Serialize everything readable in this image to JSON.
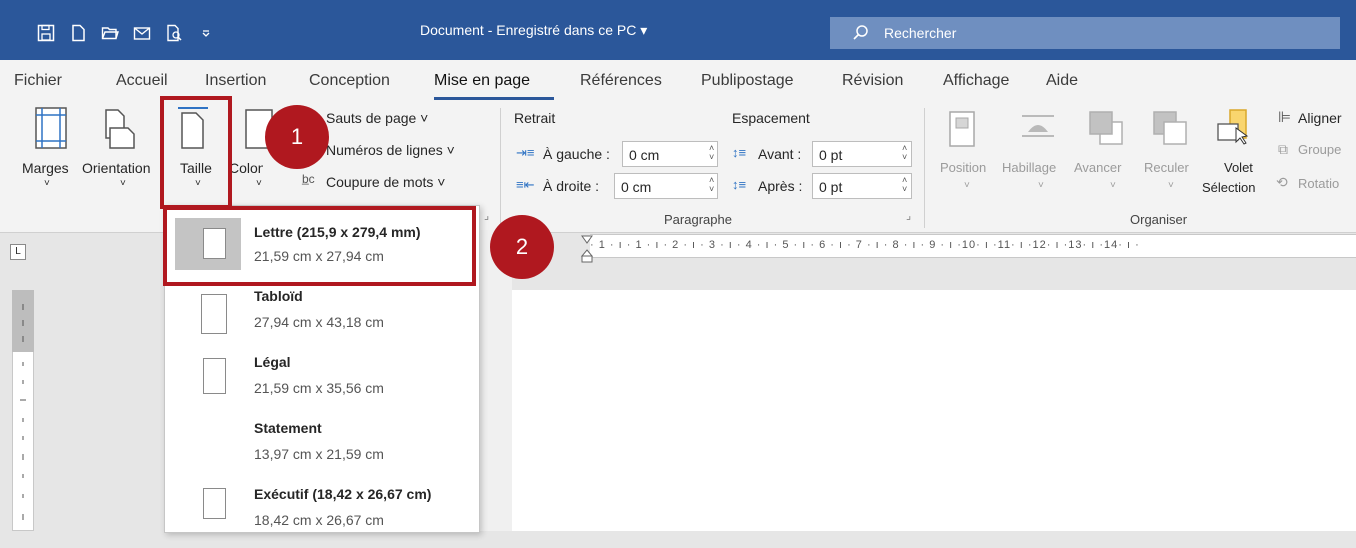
{
  "window": {
    "document_title": "Document - Enregistré dans ce PC ▾",
    "search_placeholder": "Rechercher"
  },
  "quick_access_icons": [
    "save-icon",
    "new-document-icon",
    "open-folder-icon",
    "email-icon",
    "print-preview-icon",
    "customize-qat-icon"
  ],
  "tabs": [
    "Fichier",
    "Accueil",
    "Insertion",
    "Conception",
    "Mise en page",
    "Références",
    "Publipostage",
    "Révision",
    "Affichage",
    "Aide"
  ],
  "active_tab": "Mise en page",
  "ribbon": {
    "page_setup": {
      "margins": "Marges",
      "orientation": "Orientation",
      "size": "Taille",
      "columns": "Colonnes",
      "breaks": "Sauts de page ˅",
      "line_numbers": "Numéros de lignes ˅",
      "hyphenation": "Coupure de mots ˅"
    },
    "paragraph": {
      "indent_label": "Retrait",
      "spacing_label": "Espacement",
      "left_label": "À gauche :",
      "left_value": "0 cm",
      "right_label": "À droite :",
      "right_value": "0 cm",
      "before_label": "Avant :",
      "before_value": "0 pt",
      "after_label": "Après :",
      "after_value": "0 pt",
      "group_label": "Paragraphe"
    },
    "arrange": {
      "position": "Position",
      "wrap": "Habillage",
      "forward": "Avancer",
      "backward": "Reculer",
      "selection_pane_1": "Volet",
      "selection_pane_2": "Sélection",
      "align": "Aligner",
      "group": "Groupe",
      "rotate": "Rotatio",
      "group_label": "Organiser"
    }
  },
  "ruler_text": "· 1 · ı · 1 · ı · 2 · ı · 3 · ı · 4 · ı · 5 · ı · 6 · ı · 7 · ı · 8 · ı · 9 · ı ·10· ı ·11· ı ·12· ı ·13· ı ·14· ı ·",
  "size_options": [
    {
      "name": "Lettre (215,9 x 279,4 mm)",
      "dims": "21,59 cm x 27,94 cm",
      "selected": true
    },
    {
      "name": "Tabloïd",
      "dims": "27,94 cm x 43,18 cm"
    },
    {
      "name": "Légal",
      "dims": "21,59 cm x 35,56 cm"
    },
    {
      "name": "Statement",
      "dims": "13,97 cm x 21,59 cm"
    },
    {
      "name": "Exécutif (18,42 x 26,67 cm)",
      "dims": "18,42 cm x 26,67 cm"
    }
  ],
  "annotations": {
    "badge1": "1",
    "badge2": "2"
  },
  "colors": {
    "title_bar": "#2b579a",
    "annotation_red": "#b0181f"
  }
}
